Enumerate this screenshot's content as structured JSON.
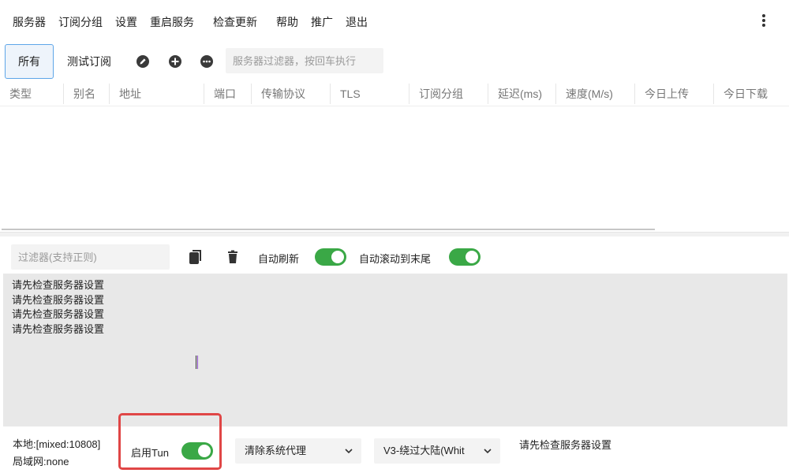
{
  "menu": {
    "servers": "服务器",
    "sub_groups": "订阅分组",
    "settings": "设置",
    "restart": "重启服务",
    "check_update": "检查更新",
    "help": "帮助",
    "promote": "推广",
    "exit": "退出",
    "more_icon": "more-vertical-icon"
  },
  "toolbar": {
    "tab_all": "所有",
    "tab_test": "测试订阅",
    "filter_placeholder": "服务器过滤器，按回车执行",
    "icons": [
      "edit-icon",
      "add-icon",
      "more-horizontal-icon"
    ]
  },
  "table": {
    "columns": [
      "类型",
      "别名",
      "地址",
      "端口",
      "传输协议",
      "TLS",
      "订阅分组",
      "延迟(ms)",
      "速度(M/s)",
      "今日上传",
      "今日下载"
    ]
  },
  "log": {
    "filter_placeholder": "过滤器(支持正则)",
    "auto_refresh_label": "自动刷新",
    "auto_refresh_on": true,
    "auto_scroll_label": "自动滚动到末尾",
    "auto_scroll_on": true,
    "lines": [
      "请先检查服务器设置",
      "请先检查服务器设置",
      "请先检查服务器设置",
      "请先检查服务器设置"
    ],
    "icons": [
      "copy-icon",
      "trash-icon"
    ]
  },
  "status": {
    "local": "本地:[mixed:10808]",
    "lan": "局域网:none",
    "tun_label": "启用Tun",
    "tun_on": true,
    "proxy_mode": "清除系统代理",
    "routing": "V3-绕过大陆(Whit",
    "message": "请先检查服务器设置",
    "highlight_color": "#e04646",
    "toggle_color": "#3aa846"
  }
}
